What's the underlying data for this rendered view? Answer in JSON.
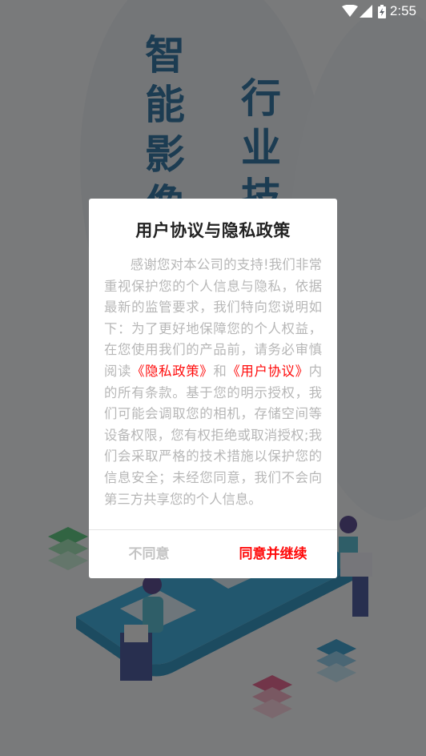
{
  "status_bar": {
    "icons": [
      "wifi-icon",
      "cell-signal-icon",
      "battery-charging-icon"
    ],
    "time": "2:55"
  },
  "background": {
    "slogan_col1": [
      "智",
      "能",
      "影",
      "像"
    ],
    "slogan_col2": [
      "行",
      "业",
      "技"
    ]
  },
  "dialog": {
    "title": "用户协议与隐私政策",
    "body_part1": "感谢您对本公司的支持!我们非常重视保护您的个人信息与隐私，依据最新的监管要求，我们特向您说明如下：为了更好地保障您的个人权益，在您使用我们的产品前，请务必审慎阅读",
    "privacy_link": "《隐私政策》",
    "body_and": "和",
    "user_agreement_link": "《用户协议》",
    "body_part2": "内的所有条款。基于您的明示授权，我们可能会调取您的相机，存储空间等设备权限，您有权拒绝或取消授权;我们会采取严格的技术措施以保护您的信息安全；未经您同意，我们不会向第三方共享您的个人信息。",
    "disagree_label": "不同意",
    "agree_label": "同意并继续"
  },
  "colors": {
    "accent_red": "#ff0a0a",
    "slogan_blue": "#0b5a92",
    "body_gray": "#b7b7b7"
  }
}
